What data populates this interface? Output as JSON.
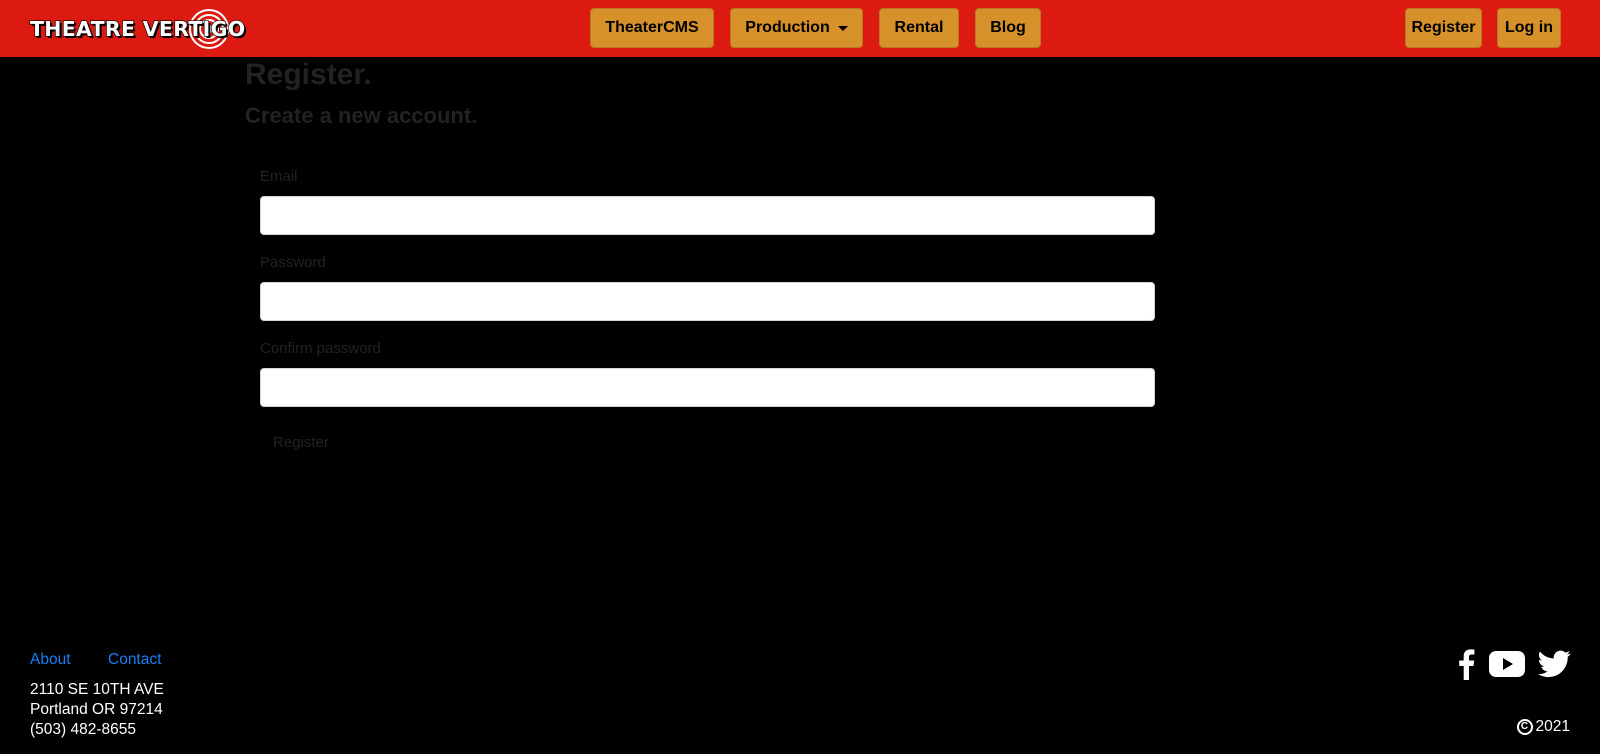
{
  "header": {
    "logo_text": "THEATRE VERTIGO",
    "nav": {
      "theatercms": "TheaterCMS",
      "production": "Production",
      "rental": "Rental",
      "blog": "Blog"
    },
    "auth": {
      "register": "Register",
      "login": "Log in"
    }
  },
  "main": {
    "title": "Register.",
    "subtitle": "Create a new account.",
    "fields": {
      "email": {
        "label": "Email",
        "value": ""
      },
      "password": {
        "label": "Password",
        "value": ""
      },
      "confirm": {
        "label": "Confirm password",
        "value": ""
      }
    },
    "submit_label": "Register"
  },
  "footer": {
    "links": {
      "about": "About",
      "contact": "Contact"
    },
    "address": {
      "street": "2110 SE 10TH AVE",
      "city": "Portland OR 97214",
      "phone": "(503) 482-8655"
    },
    "copyright_year": "2021",
    "social_icons": [
      "facebook-icon",
      "youtube-icon",
      "twitter-icon"
    ]
  },
  "colors": {
    "header_bg": "#dc1a12",
    "nav_button": "#d6912a",
    "page_bg": "#000000",
    "link": "#1a7ef2"
  }
}
